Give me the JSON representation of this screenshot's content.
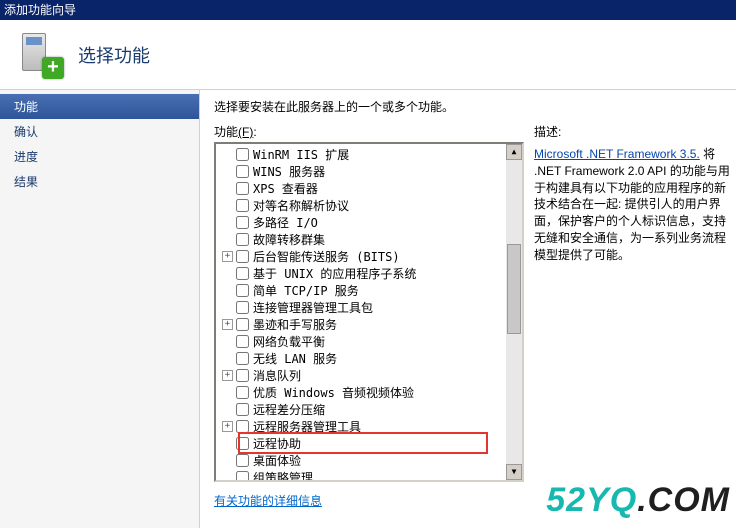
{
  "window": {
    "title": "添加功能向导"
  },
  "header": {
    "title": "选择功能"
  },
  "sidebar": {
    "items": [
      {
        "label": "功能",
        "active": true
      },
      {
        "label": "确认",
        "active": false
      },
      {
        "label": "进度",
        "active": false
      },
      {
        "label": "结果",
        "active": false
      }
    ]
  },
  "main": {
    "instruction": "选择要安装在此服务器上的一个或多个功能。",
    "features_label_prefix": "功能",
    "features_label_key": "(F)",
    "features_label_suffix": ":",
    "tree": [
      {
        "label": "WinRM IIS 扩展",
        "expander": null
      },
      {
        "label": "WINS 服务器",
        "expander": null
      },
      {
        "label": "XPS 查看器",
        "expander": null
      },
      {
        "label": "对等名称解析协议",
        "expander": null
      },
      {
        "label": "多路径 I/O",
        "expander": null
      },
      {
        "label": "故障转移群集",
        "expander": null
      },
      {
        "label": "后台智能传送服务 (BITS)",
        "expander": "+"
      },
      {
        "label": "基于 UNIX 的应用程序子系统",
        "expander": null
      },
      {
        "label": "简单 TCP/IP 服务",
        "expander": null
      },
      {
        "label": "连接管理器管理工具包",
        "expander": null
      },
      {
        "label": "墨迹和手写服务",
        "expander": "+"
      },
      {
        "label": "网络负载平衡",
        "expander": null
      },
      {
        "label": "无线 LAN 服务",
        "expander": null
      },
      {
        "label": "消息队列",
        "expander": "+"
      },
      {
        "label": "优质 Windows 音频视频体验",
        "expander": null
      },
      {
        "label": "远程差分压缩",
        "expander": null
      },
      {
        "label": "远程服务器管理工具",
        "expander": "+"
      },
      {
        "label": "远程协助",
        "expander": null,
        "highlight": true
      },
      {
        "label": "桌面体验",
        "expander": null
      },
      {
        "label": "组策略管理",
        "expander": null
      }
    ],
    "details_link": "有关功能的详细信息",
    "description": {
      "label": "描述:",
      "link": "Microsoft .NET Framework 3.5.",
      "text": "将 .NET Framework 2.0 API 的功能与用于构建具有以下功能的应用程序的新技术结合在一起: 提供引人的用户界面，保护客户的个人标识信息，支持无缝和安全通信，为一系列业务流程模型提供了可能。"
    }
  },
  "watermark": {
    "teal": "52YQ",
    "dark": ".COM"
  }
}
